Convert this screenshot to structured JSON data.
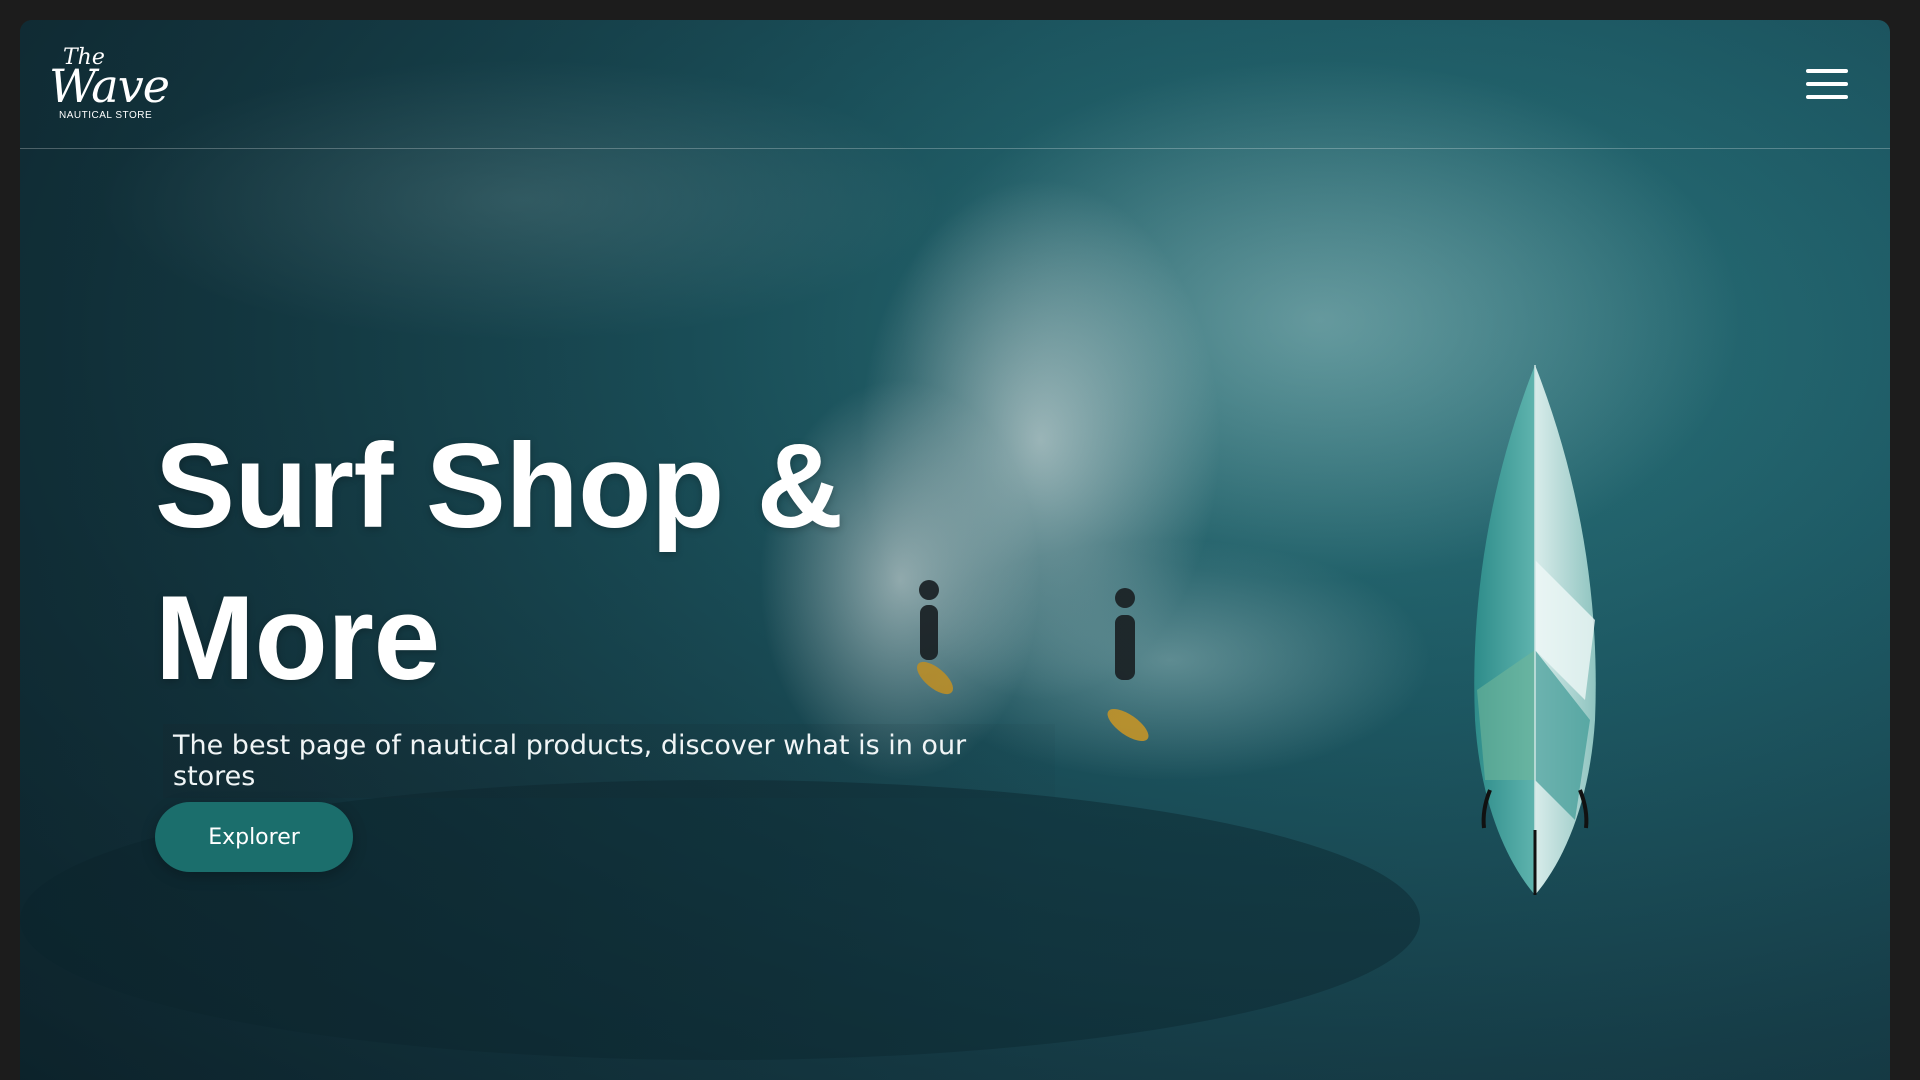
{
  "header": {
    "logo": {
      "top": "The",
      "main": "Wave",
      "tagline": "NAUTICAL STORE"
    },
    "menu_icon": "hamburger-menu-icon"
  },
  "hero": {
    "title_line1": "Surf Shop &",
    "title_line2": "More",
    "subtitle": "The best page of nautical products, discover what is in our stores",
    "cta_label": "Explorer"
  },
  "colors": {
    "page_background": "#1c1c1c",
    "ocean_teal": "#1f5e69",
    "cta_background": "#1b6e6c",
    "text": "#ffffff"
  }
}
